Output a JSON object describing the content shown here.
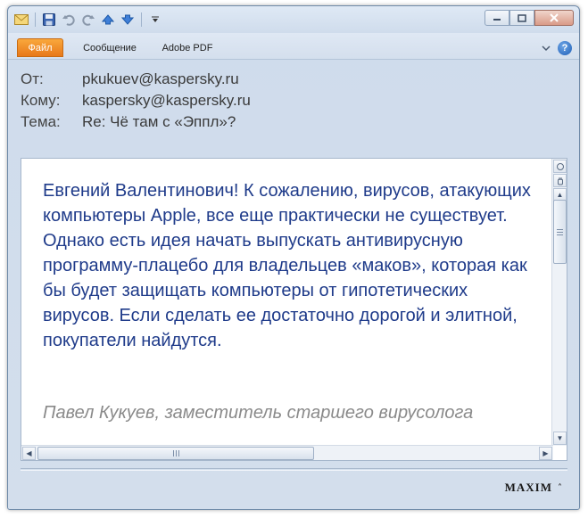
{
  "ribbon": {
    "tabs": [
      {
        "label": "Файл"
      },
      {
        "label": "Сообщение"
      },
      {
        "label": "Adobe PDF"
      }
    ],
    "help_symbol": "?"
  },
  "header": {
    "from_label": "От:",
    "from_value": "pkukuev@kaspersky.ru",
    "to_label": "Кому:",
    "to_value": "kaspersky@kaspersky.ru",
    "subject_label": "Тема:",
    "subject_value": "Re: Чё там с «Эппл»?"
  },
  "message": {
    "body": "Евгений Валентинович! К сожалению, вирусов, атакующих компьютеры Apple, все еще практически не существует. Однако есть идея начать выпускать антивирусную программу-плацебо для владельцев «маков», которая как бы будет защищать компьютеры от гипотетических вирусов. Если сделать ее достаточно дорогой и элитной, покупатели найдутся.",
    "signature": "Павел Кукуев, заместитель старшего вирусолога"
  },
  "footer": {
    "brand": "MAXIM"
  },
  "colors": {
    "body_text": "#1f3b8a",
    "signature_text": "#8a8a8a",
    "file_tab": "#e8781a"
  },
  "icons": [
    "envelope-icon",
    "save-icon",
    "undo-icon",
    "redo-icon",
    "up-arrow-icon",
    "down-arrow-icon",
    "customize-dropdown-icon",
    "minimize-icon",
    "maximize-icon",
    "close-icon",
    "ribbon-collapse-icon",
    "help-icon"
  ]
}
